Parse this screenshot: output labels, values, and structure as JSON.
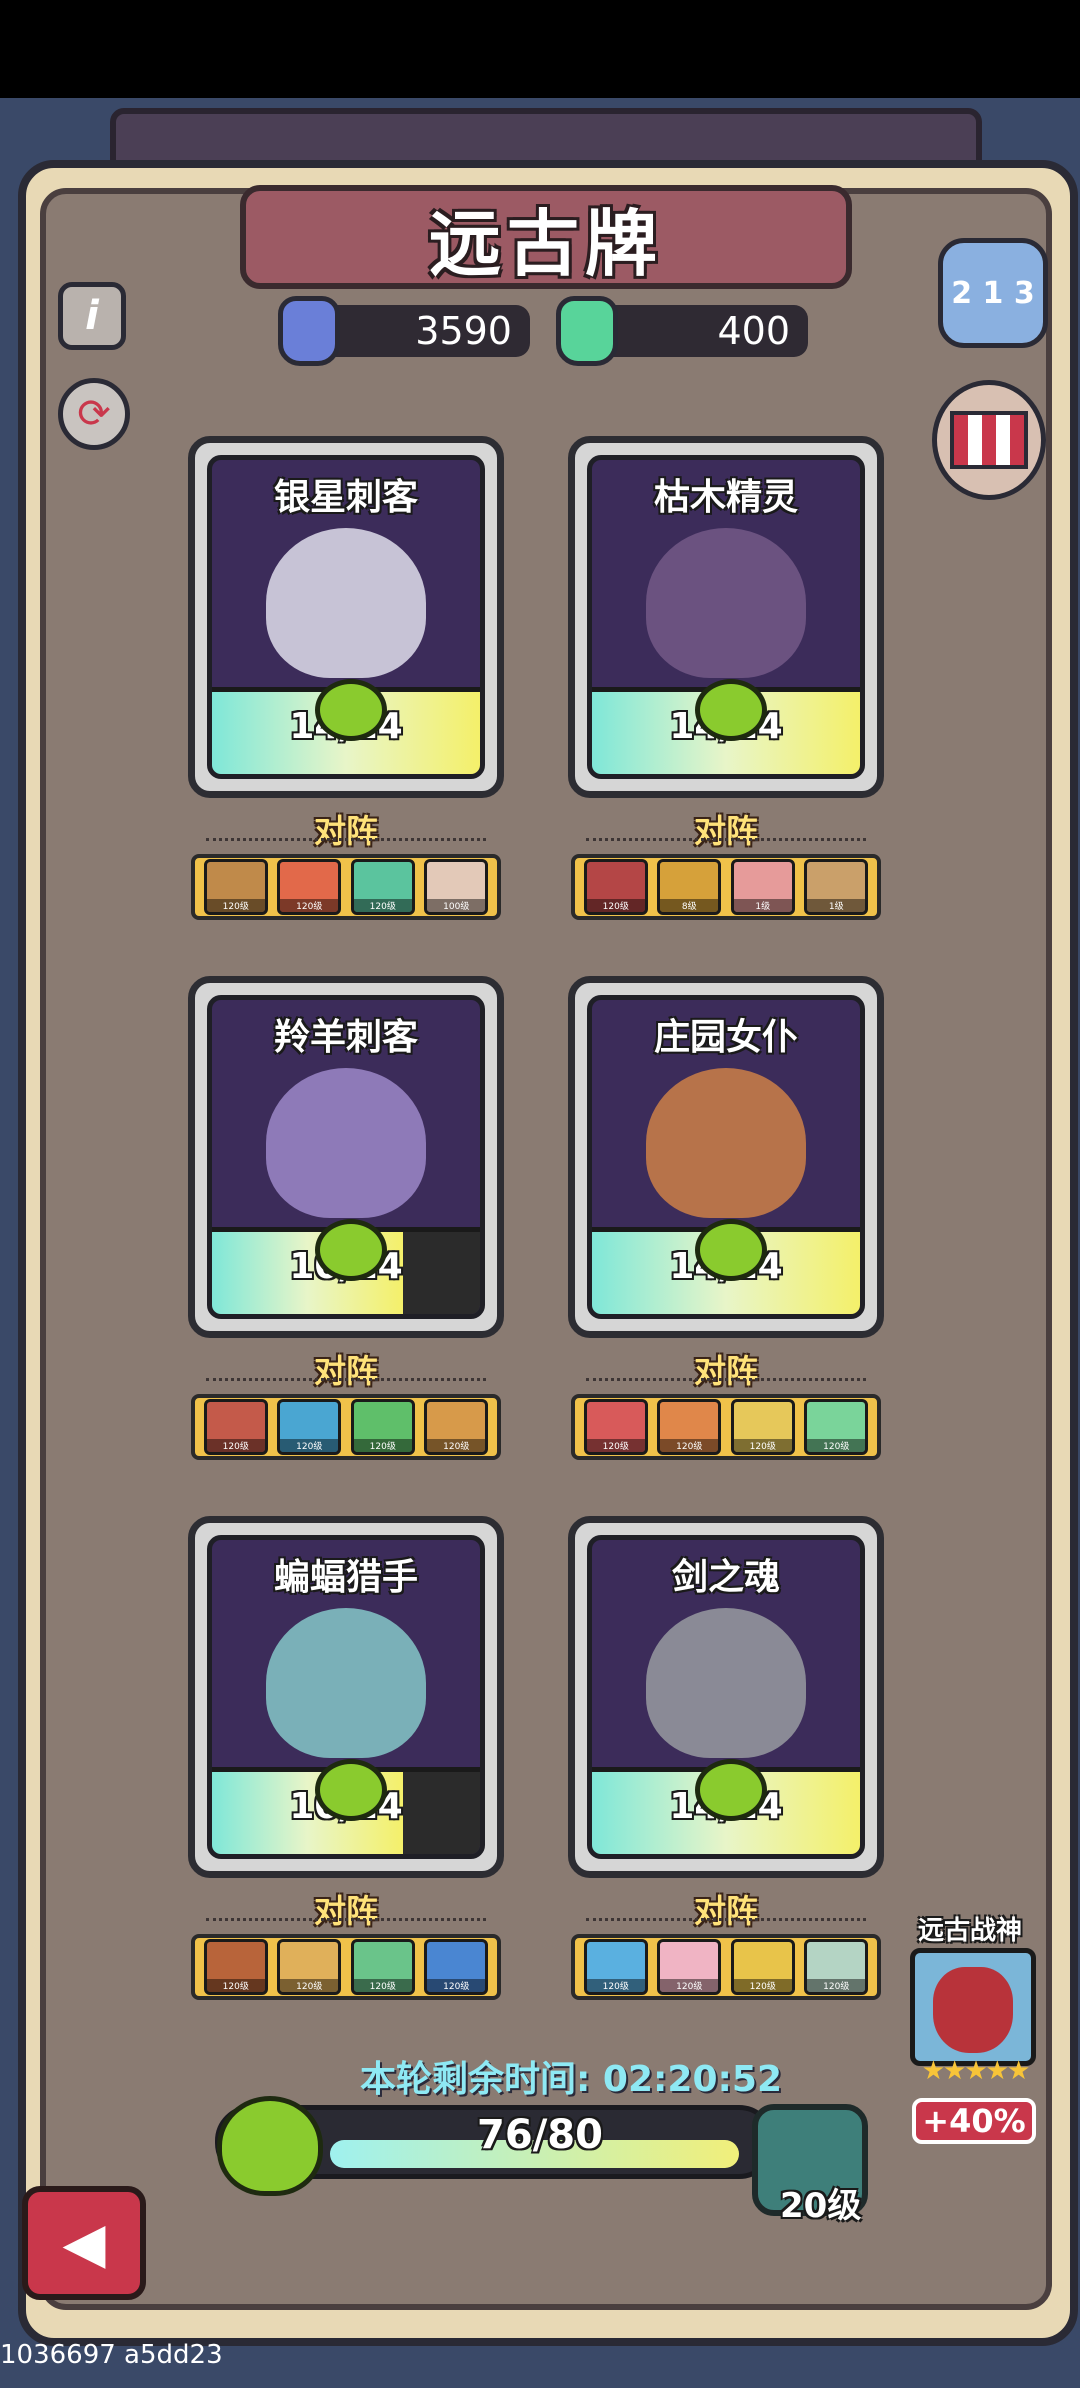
{
  "title": "远古牌",
  "currencies": {
    "blue_gem": {
      "value": "3590",
      "icon": "blue-rune-gem-icon",
      "color": "#6a7fd8"
    },
    "green_gem": {
      "value": "400",
      "icon": "green-crystal-gem-icon",
      "color": "#58d49a"
    }
  },
  "side_buttons": {
    "info": {
      "icon": "info-icon"
    },
    "refresh": {
      "icon": "refresh-icon"
    },
    "ranking": {
      "icon": "podium-icon"
    },
    "shop": {
      "icon": "shop-icon"
    }
  },
  "vs_label": "对阵",
  "cards": [
    {
      "name": "银星刺客",
      "progress": "14/14",
      "progress_value": 14,
      "progress_max": 14,
      "portrait_color": "#c7c3d6",
      "team": [
        {
          "color": "#c08a4a",
          "lv": "120级"
        },
        {
          "color": "#e2694a",
          "lv": "120级"
        },
        {
          "color": "#5bc49e",
          "lv": "120级"
        },
        {
          "color": "#e3c9b8",
          "lv": "100级"
        }
      ]
    },
    {
      "name": "枯木精灵",
      "progress": "14/14",
      "progress_value": 14,
      "progress_max": 14,
      "portrait_color": "#6b5280",
      "team": [
        {
          "color": "#b44646",
          "lv": "120级"
        },
        {
          "color": "#d6a13a",
          "lv": "8级"
        },
        {
          "color": "#e69b9a",
          "lv": "1级"
        },
        {
          "color": "#caa06a",
          "lv": "1级"
        }
      ]
    },
    {
      "name": "羚羊刺客",
      "progress": "10/14",
      "progress_value": 10,
      "progress_max": 14,
      "portrait_color": "#8e7ab8",
      "team": [
        {
          "color": "#c45a4a",
          "lv": "120级"
        },
        {
          "color": "#4aa6d2",
          "lv": "120级"
        },
        {
          "color": "#5fbf6a",
          "lv": "120级"
        },
        {
          "color": "#d79a4a",
          "lv": "120级"
        }
      ]
    },
    {
      "name": "庄园女仆",
      "progress": "14/14",
      "progress_value": 14,
      "progress_max": 14,
      "portrait_color": "#b7734a",
      "team": [
        {
          "color": "#d85a5a",
          "lv": "120级"
        },
        {
          "color": "#e0874a",
          "lv": "120级"
        },
        {
          "color": "#e6c85a",
          "lv": "120级"
        },
        {
          "color": "#7ad49a",
          "lv": "120级"
        }
      ]
    },
    {
      "name": "蝙蝠猎手",
      "progress": "10/14",
      "progress_value": 10,
      "progress_max": 14,
      "portrait_color": "#7ab0b8",
      "team": [
        {
          "color": "#b8643a",
          "lv": "120级"
        },
        {
          "color": "#e0b05a",
          "lv": "120级"
        },
        {
          "color": "#6ac48a",
          "lv": "120级"
        },
        {
          "color": "#4a86d2",
          "lv": "120级"
        }
      ]
    },
    {
      "name": "剑之魂",
      "progress": "14/14",
      "progress_value": 14,
      "progress_max": 14,
      "portrait_color": "#8a8a96",
      "team": [
        {
          "color": "#5ab0e0",
          "lv": "120级"
        },
        {
          "color": "#f0b4c4",
          "lv": "120级"
        },
        {
          "color": "#e8c44a",
          "lv": "120级"
        },
        {
          "color": "#b4d4c4",
          "lv": "120级"
        }
      ]
    }
  ],
  "timer": "本轮剩余时间: 02:20:52",
  "xp": {
    "text": "76/80",
    "value": 76,
    "max": 80
  },
  "chest_level": "20级",
  "boss": {
    "label": "远古战神",
    "stars": "★★★★★",
    "bonus": "+40%",
    "portrait_color": "#b8333a"
  },
  "back_button": {
    "icon": "back-arrow-icon"
  },
  "footer_id": "1036697 a5dd23"
}
